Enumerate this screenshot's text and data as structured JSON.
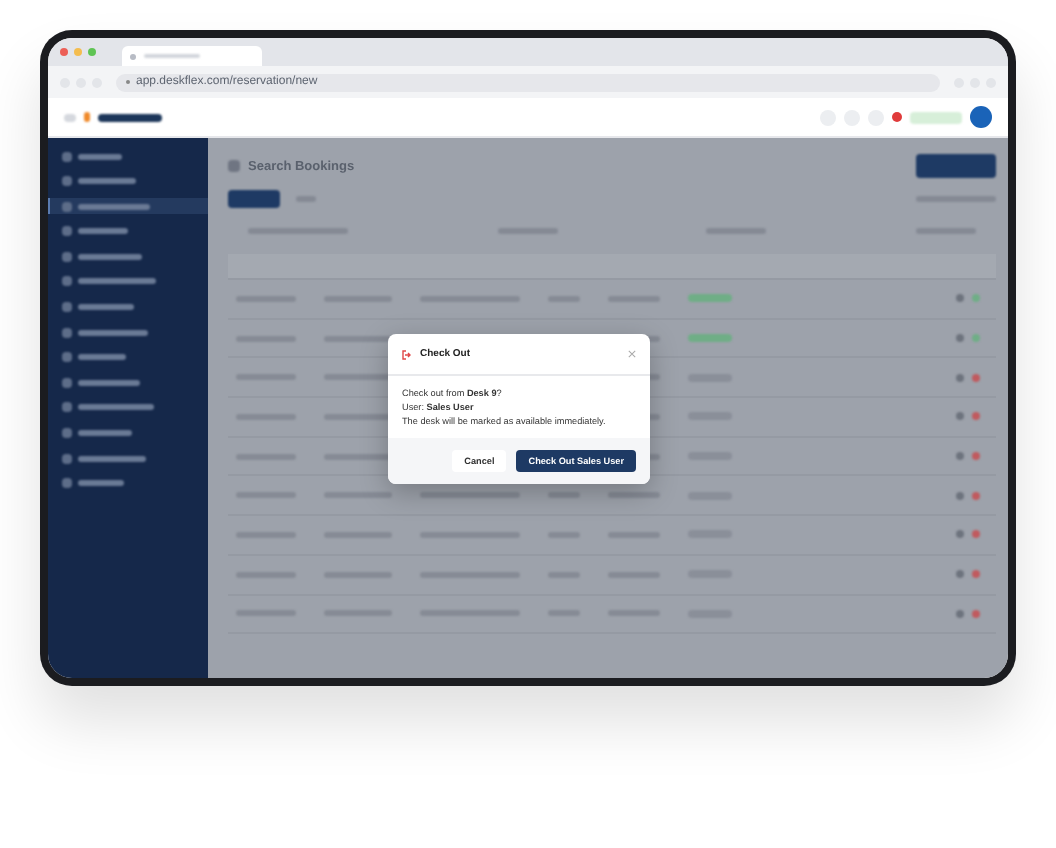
{
  "browser": {
    "url": "app.deskflex.com/reservation/new"
  },
  "page": {
    "title": "Search Bookings"
  },
  "sidebar": {
    "items": [
      {
        "selected": false
      },
      {
        "selected": false
      },
      {
        "selected": true
      },
      {
        "selected": false
      },
      {
        "selected": false
      },
      {
        "selected": false
      },
      {
        "selected": false
      },
      {
        "selected": false
      },
      {
        "selected": false
      },
      {
        "selected": false
      },
      {
        "selected": false
      },
      {
        "selected": false
      },
      {
        "selected": false
      },
      {
        "selected": false
      }
    ]
  },
  "rows": [
    {
      "checked_in": true
    },
    {
      "checked_in": true
    },
    {
      "checked_in": false
    },
    {
      "checked_in": false
    },
    {
      "checked_in": false
    },
    {
      "checked_in": false
    },
    {
      "checked_in": false
    },
    {
      "checked_in": false
    },
    {
      "checked_in": false
    }
  ],
  "dialog": {
    "title": "Check Out",
    "lines": [
      "Check out from **Desk 9**?",
      "User: **Sales User**",
      "The desk will be marked as available immediately."
    ],
    "buttons": [
      {
        "label": "Cancel",
        "kind": "secondary"
      },
      {
        "label": "Check Out Sales User",
        "kind": "primary"
      }
    ]
  }
}
